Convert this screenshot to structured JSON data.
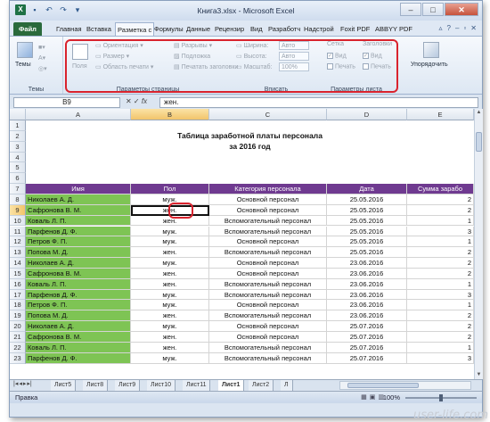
{
  "window": {
    "title": "Книга3.xlsx - Microsoft Excel"
  },
  "ribbon_tabs": [
    "Файл",
    "Главная",
    "Вставка",
    "Разметка с",
    "Формулы",
    "Данные",
    "Рецензир",
    "Вид",
    "Разработч",
    "Надстрой",
    "Foxit PDF",
    "ABBYY PDF"
  ],
  "ribbon": {
    "themes": {
      "label": "Темы",
      "button": "Темы"
    },
    "page_setup": {
      "fields_label": "Поля",
      "orientation": "Ориентация",
      "size": "Размер",
      "print_area": "Область печати",
      "breaks": "Разрывы",
      "background": "Подложка",
      "print_titles": "Печатать заголовки",
      "group_label": "Параметры страницы"
    },
    "fit": {
      "width": "Ширина:",
      "width_val": "Авто",
      "height": "Высота:",
      "height_val": "Авто",
      "scale": "Масштаб:",
      "scale_val": "100%",
      "group_label": "Вписать"
    },
    "sheet_options": {
      "gridlines": "Сетка",
      "headings": "Заголовки",
      "view": "Вид",
      "print": "Печать",
      "group_label": "Параметры листа"
    },
    "arrange": {
      "label": "Упорядочить"
    }
  },
  "formula_bar": {
    "name_box": "B9",
    "fx": "fx",
    "value": "жен."
  },
  "columns": [
    "A",
    "B",
    "C",
    "D",
    "E"
  ],
  "sheet_title": "Таблица заработной платы персонала",
  "sheet_subtitle": "за 2016 год",
  "table_headers": [
    "Имя",
    "Пол",
    "Категория персонала",
    "Дата",
    "Сумма зарабо"
  ],
  "rows": [
    {
      "n": "8",
      "name": "Николаев А. Д.",
      "sex": "муж.",
      "cat": "Основной персонал",
      "date": "25.05.2016",
      "sum": "2"
    },
    {
      "n": "9",
      "name": "Сафронова В. М.",
      "sex": "жен.",
      "cat": "Основной персонал",
      "date": "25.05.2016",
      "sum": "2"
    },
    {
      "n": "10",
      "name": "Коваль Л. П.",
      "sex": "жен.",
      "cat": "Вспомогательный персонал",
      "date": "25.05.2016",
      "sum": "1"
    },
    {
      "n": "11",
      "name": "Парфенов Д. Ф.",
      "sex": "муж.",
      "cat": "Вспомогательный персонал",
      "date": "25.05.2016",
      "sum": "3"
    },
    {
      "n": "12",
      "name": "Петров Ф. П.",
      "sex": "муж.",
      "cat": "Основной персонал",
      "date": "25.05.2016",
      "sum": "1"
    },
    {
      "n": "13",
      "name": "Попова М. Д.",
      "sex": "жен.",
      "cat": "Вспомогательный персонал",
      "date": "25.05.2016",
      "sum": "2"
    },
    {
      "n": "14",
      "name": "Николаев А. Д.",
      "sex": "муж.",
      "cat": "Основной персонал",
      "date": "23.06.2016",
      "sum": "2"
    },
    {
      "n": "15",
      "name": "Сафронова В. М.",
      "sex": "жен.",
      "cat": "Основной персонал",
      "date": "23.06.2016",
      "sum": "2"
    },
    {
      "n": "16",
      "name": "Коваль Л. П.",
      "sex": "жен.",
      "cat": "Вспомогательный персонал",
      "date": "23.06.2016",
      "sum": "1"
    },
    {
      "n": "17",
      "name": "Парфенов Д. Ф.",
      "sex": "муж.",
      "cat": "Вспомогательный персонал",
      "date": "23.06.2016",
      "sum": "3"
    },
    {
      "n": "18",
      "name": "Петров Ф. П.",
      "sex": "муж.",
      "cat": "Основной персонал",
      "date": "23.06.2016",
      "sum": "1"
    },
    {
      "n": "19",
      "name": "Попова М. Д.",
      "sex": "жен.",
      "cat": "Вспомогательный персонал",
      "date": "23.06.2016",
      "sum": "2"
    },
    {
      "n": "20",
      "name": "Николаев А. Д.",
      "sex": "муж.",
      "cat": "Основной персонал",
      "date": "25.07.2016",
      "sum": "2"
    },
    {
      "n": "21",
      "name": "Сафронова В. М.",
      "sex": "жен.",
      "cat": "Основной персонал",
      "date": "25.07.2016",
      "sum": "2"
    },
    {
      "n": "22",
      "name": "Коваль Л. П.",
      "sex": "жен.",
      "cat": "Вспомогательный персонал",
      "date": "25.07.2016",
      "sum": "1"
    },
    {
      "n": "23",
      "name": "Парфенов Д. Ф.",
      "sex": "муж.",
      "cat": "Вспомогательный персонал",
      "date": "25.07.2016",
      "sum": "3"
    }
  ],
  "top_rows": [
    "1",
    "2",
    "3",
    "4",
    "5",
    "6",
    "7"
  ],
  "sheet_tabs": [
    "Лист5",
    "Лист8",
    "Лист9",
    "Лист10",
    "Лист11",
    "Лист1",
    "Лист2",
    "Л"
  ],
  "status": {
    "ready": "Правка",
    "zoom": "100%"
  },
  "watermark": "user-life.com"
}
